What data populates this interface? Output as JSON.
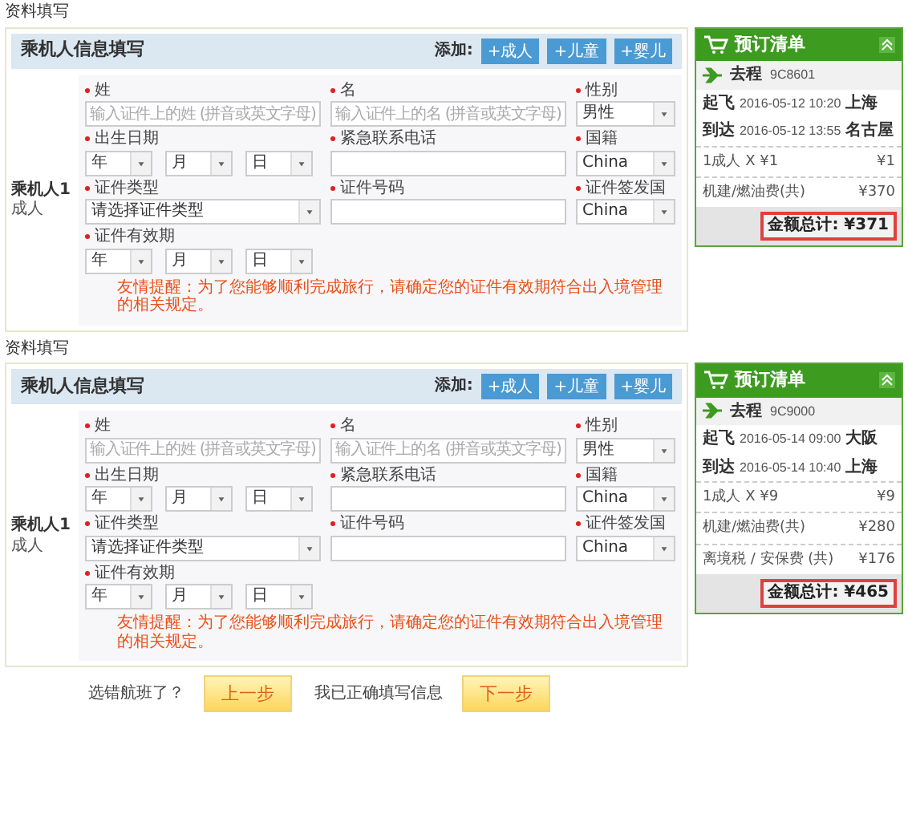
{
  "sections": [
    {
      "caption": "资料填写",
      "form": {
        "title": "乘机人信息填写",
        "add_label": "添加:",
        "add_buttons": [
          "+成人",
          "+儿童",
          "+婴儿"
        ],
        "passenger": {
          "label": "乘机人1",
          "type": "成人"
        },
        "fields": [
          {
            "label": "姓",
            "required": true,
            "kind": "text",
            "placeholder": "输入证件上的姓 (拼音或英文字母)"
          },
          {
            "label": "名",
            "required": true,
            "kind": "text",
            "placeholder": "输入证件上的名 (拼音或英文字母)"
          },
          {
            "label": "性别",
            "required": true,
            "kind": "select",
            "value": "男性"
          },
          {
            "label": "出生日期",
            "required": true,
            "kind": "date",
            "parts": [
              "年",
              "月",
              "日"
            ]
          },
          {
            "label": "紧急联系电话",
            "required": true,
            "kind": "text"
          },
          {
            "label": "国籍",
            "required": true,
            "kind": "select",
            "value": "China"
          },
          {
            "label": "证件类型",
            "required": true,
            "kind": "select",
            "value": "请选择证件类型"
          },
          {
            "label": "证件号码",
            "required": true,
            "kind": "text"
          },
          {
            "label": "证件签发国",
            "required": true,
            "kind": "select",
            "value": "China"
          },
          {
            "label": "证件有效期",
            "required": true,
            "kind": "date",
            "parts": [
              "年",
              "月",
              "日"
            ]
          }
        ],
        "notice": "友情提醒：为了您能够顺利完成旅行，请确定您的证件有效期符合出入境管理的相关规定。"
      },
      "order": {
        "title": "预订清单",
        "trip": "去程",
        "flight": "9C8601",
        "legs": [
          {
            "label": "起飞",
            "time": "2016-05-12 10:20",
            "city": "上海"
          },
          {
            "label": "到达",
            "time": "2016-05-12 13:55",
            "city": "名古屋"
          }
        ],
        "lines": [
          {
            "label": "1成人 X ¥1",
            "amount": "¥1"
          },
          {
            "label": "机建/燃油费(共)",
            "amount": "¥370"
          }
        ],
        "total": "金额总计: ¥371"
      }
    },
    {
      "caption": "资料填写",
      "form": {
        "title": "乘机人信息填写",
        "add_label": "添加:",
        "add_buttons": [
          "+成人",
          "+儿童",
          "+婴儿"
        ],
        "passenger": {
          "label": "乘机人1",
          "type": "成人"
        },
        "fields": [
          {
            "label": "姓",
            "required": true,
            "kind": "text",
            "placeholder": "输入证件上的姓 (拼音或英文字母)"
          },
          {
            "label": "名",
            "required": true,
            "kind": "text",
            "placeholder": "输入证件上的名 (拼音或英文字母)"
          },
          {
            "label": "性别",
            "required": true,
            "kind": "select",
            "value": "男性"
          },
          {
            "label": "出生日期",
            "required": true,
            "kind": "date",
            "parts": [
              "年",
              "月",
              "日"
            ]
          },
          {
            "label": "紧急联系电话",
            "required": true,
            "kind": "text"
          },
          {
            "label": "国籍",
            "required": true,
            "kind": "select",
            "value": "China"
          },
          {
            "label": "证件类型",
            "required": true,
            "kind": "select",
            "value": "请选择证件类型"
          },
          {
            "label": "证件号码",
            "required": true,
            "kind": "text"
          },
          {
            "label": "证件签发国",
            "required": true,
            "kind": "select",
            "value": "China"
          },
          {
            "label": "证件有效期",
            "required": true,
            "kind": "date",
            "parts": [
              "年",
              "月",
              "日"
            ]
          }
        ],
        "notice": "友情提醒：为了您能够顺利完成旅行，请确定您的证件有效期符合出入境管理的相关规定。"
      },
      "order": {
        "title": "预订清单",
        "trip": "去程",
        "flight": "9C9000",
        "legs": [
          {
            "label": "起飞",
            "time": "2016-05-14 09:00",
            "city": "大阪"
          },
          {
            "label": "到达",
            "time": "2016-05-14 10:40",
            "city": "上海"
          }
        ],
        "lines": [
          {
            "label": "1成人 X ¥9",
            "amount": "¥9"
          },
          {
            "label": "机建/燃油费(共)",
            "amount": "¥280"
          },
          {
            "label": "离境税 / 安保费 (共)",
            "amount": "¥176"
          }
        ],
        "total": "金额总计: ¥465"
      }
    }
  ],
  "footer": [
    {
      "text": "选错航班了？",
      "button": "上一步"
    },
    {
      "text": "我已正确填写信息",
      "button": "下一步"
    }
  ]
}
